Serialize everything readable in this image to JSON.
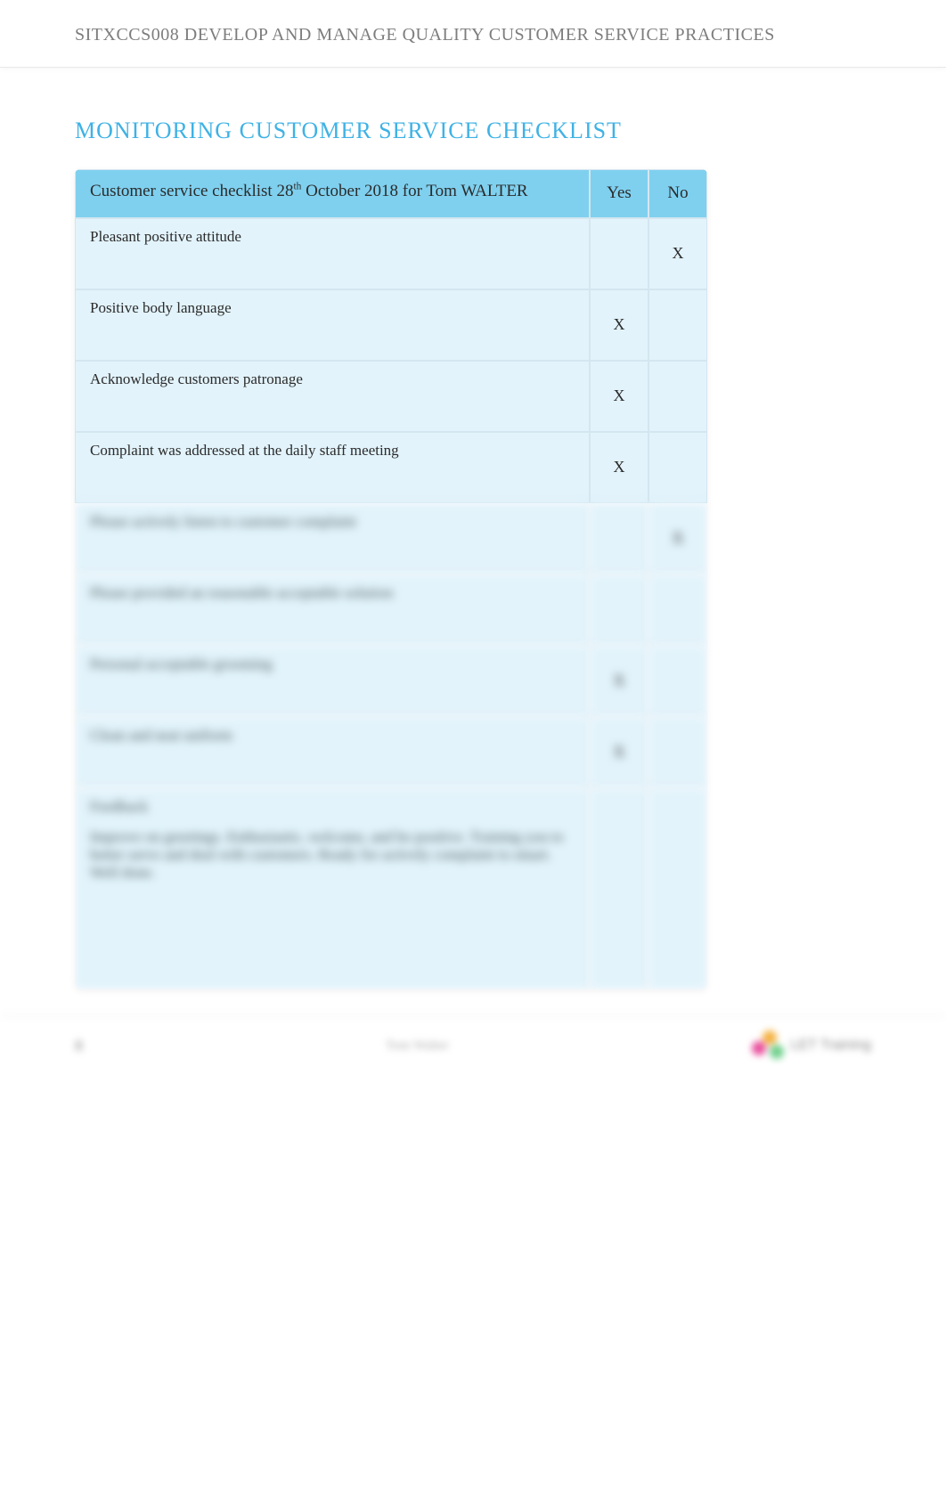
{
  "header": {
    "course_title": "SITXCCS008 DEVELOP AND MANAGE QUALITY CUSTOMER SERVICE PRACTICES"
  },
  "section": {
    "heading": "MONITORING CUSTOMER SERVICE CHECKLIST"
  },
  "table": {
    "header_desc_pre": "Customer service checklist 28",
    "header_desc_sup": "th",
    "header_desc_post": " October 2018 for Tom WALTER",
    "yes_label": "Yes",
    "no_label": "No",
    "rows": [
      {
        "desc": "Pleasant    positive attitude",
        "yes": "",
        "no": "X",
        "blurred": false
      },
      {
        "desc": "Positive body language",
        "yes": "X",
        "no": "",
        "blurred": false
      },
      {
        "desc": "Acknowledge customers patronage",
        "yes": "X",
        "no": "",
        "blurred": false
      },
      {
        "desc": "Complaint was addressed at the daily staff meeting",
        "yes": "X",
        "no": "",
        "blurred": false
      },
      {
        "desc": "Please actively listen to customer complaint",
        "yes": "",
        "no": "X",
        "blurred": true
      },
      {
        "desc": "Please provided an reasonable acceptable solution",
        "yes": "",
        "no": "",
        "blurred": true
      },
      {
        "desc": "Personal acceptable grooming",
        "yes": "X",
        "no": "",
        "blurred": true
      },
      {
        "desc": "Clean and neat uniform",
        "yes": "X",
        "no": "",
        "blurred": true
      }
    ],
    "feedback_label": "Feedback",
    "feedback_text": "Improve on greetings. Enthusiastic, welcome, and be positive. Training you to better serve and deal with customers. Ready for actively complaint to smart. Well done."
  },
  "footer": {
    "page_number": "8",
    "center_text": "Tom Walter",
    "logo_text": "LET Training"
  }
}
